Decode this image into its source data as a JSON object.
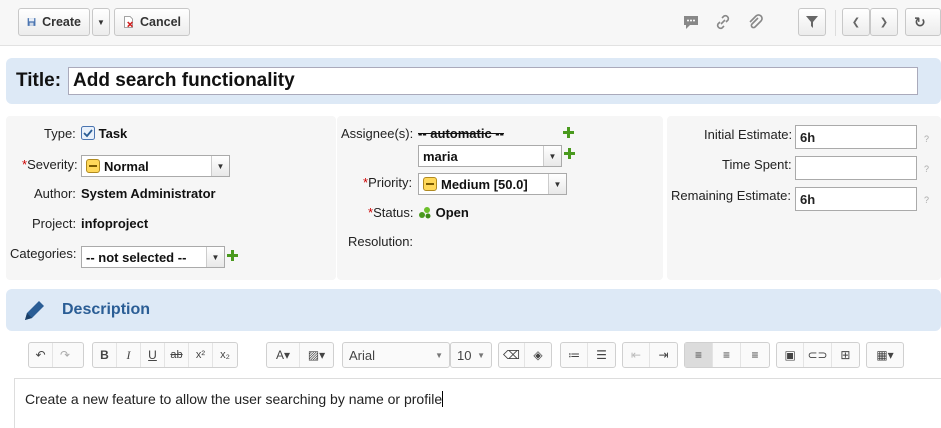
{
  "toolbar": {
    "create_label": "Create",
    "cancel_label": "Cancel"
  },
  "title": {
    "label": "Title:",
    "value": "Add search functionality"
  },
  "fields": {
    "type_label": "Type:",
    "type_value": "Task",
    "severity_label": "Severity:",
    "severity_value": "Normal",
    "author_label": "Author:",
    "author_value": "System Administrator",
    "project_label": "Project:",
    "project_value": "infoproject",
    "categories_label": "Categories:",
    "categories_value": "-- not selected --",
    "assignees_label": "Assignee(s):",
    "assignee_auto": "-- automatic --",
    "assignee_value": "maria",
    "priority_label": "Priority:",
    "priority_value": "Medium [50.0]",
    "status_label": "Status:",
    "status_value": "Open",
    "resolution_label": "Resolution:",
    "initial_estimate_label": "Initial Estimate:",
    "initial_estimate_value": "6h",
    "time_spent_label": "Time Spent:",
    "time_spent_value": "",
    "remaining_estimate_label": "Remaining Estimate:",
    "remaining_estimate_value": "6h",
    "help_mark": "?"
  },
  "description": {
    "title": "Description",
    "text": "Create a new feature to allow the user searching by name or profile"
  },
  "editor_toolbar": {
    "font_family": "Arial",
    "font_size": "10"
  },
  "colors": {
    "band": "#dde9f6",
    "accent": "#2a5d95",
    "required": "#cc0000",
    "add_green": "#4a9a1e"
  }
}
